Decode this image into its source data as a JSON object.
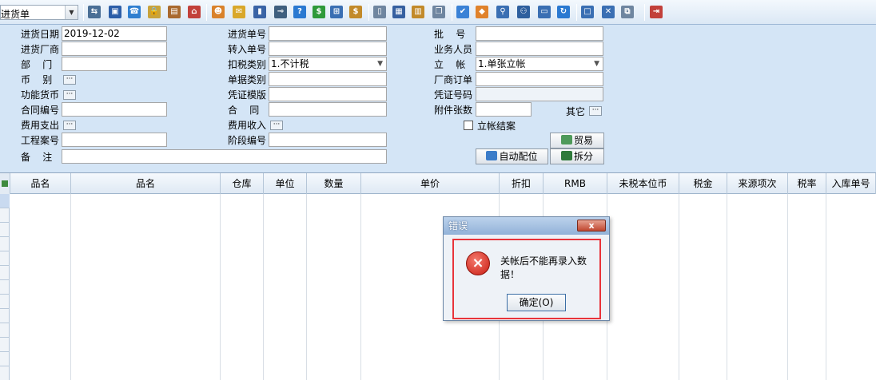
{
  "toolbar": {
    "doc_type_value": "进货单",
    "icons": [
      {
        "name": "split-icon",
        "glyph": "⇆",
        "color": "#4a6f96"
      },
      {
        "name": "monitor-icon",
        "glyph": "▣",
        "color": "#2c5ea8"
      },
      {
        "name": "phone-icon",
        "glyph": "☎",
        "color": "#2f7fd0"
      },
      {
        "name": "lock-icon",
        "glyph": "🔒",
        "color": "#c9a33a"
      },
      {
        "name": "briefcase-icon",
        "glyph": "▤",
        "color": "#a9692e"
      },
      {
        "name": "home-icon",
        "glyph": "⌂",
        "color": "#c2403a"
      },
      {
        "name": "users-icon",
        "glyph": "☻",
        "color": "#d9822b"
      },
      {
        "name": "mail-icon",
        "glyph": "✉",
        "color": "#d9a82b"
      },
      {
        "name": "book-icon",
        "glyph": "▮",
        "color": "#3a64a6"
      },
      {
        "name": "key-icon",
        "glyph": "⊸",
        "color": "#3f5f7f"
      },
      {
        "name": "help-icon",
        "glyph": "?",
        "color": "#2a79d1"
      },
      {
        "name": "dollar-icon",
        "glyph": "$",
        "color": "#2f9a3a"
      },
      {
        "name": "cart-icon",
        "glyph": "⊞",
        "color": "#3a6fb3"
      },
      {
        "name": "money-bag-icon",
        "glyph": "$",
        "color": "#c28a2a"
      },
      {
        "name": "document-icon",
        "glyph": "▯",
        "color": "#6f86a0"
      },
      {
        "name": "calculator-icon",
        "glyph": "▦",
        "color": "#3660a0"
      },
      {
        "name": "archive-icon",
        "glyph": "▥",
        "color": "#c28a2a"
      },
      {
        "name": "copy-icon",
        "glyph": "❐",
        "color": "#6f86a0"
      },
      {
        "name": "check-icon",
        "glyph": "✔",
        "color": "#3a82d6"
      },
      {
        "name": "bell-icon",
        "glyph": "◆",
        "color": "#e0822b"
      },
      {
        "name": "search-doc-icon",
        "glyph": "⚲",
        "color": "#3a6fb3"
      },
      {
        "name": "org-chart-icon",
        "glyph": "⚇",
        "color": "#2e5f9e"
      },
      {
        "name": "screen-icon",
        "glyph": "▭",
        "color": "#3a6fb3"
      },
      {
        "name": "refresh-icon",
        "glyph": "↻",
        "color": "#2a79d1"
      },
      {
        "name": "window-icon",
        "glyph": "□",
        "color": "#3a6fb3"
      },
      {
        "name": "close-window-icon",
        "glyph": "✕",
        "color": "#3a6fb3"
      },
      {
        "name": "tile-icon",
        "glyph": "⧉",
        "color": "#6f86a0"
      },
      {
        "name": "exit-icon",
        "glyph": "⇥",
        "color": "#c2403a"
      }
    ]
  },
  "form": {
    "purchase_date_label": "进货日期",
    "purchase_date_value": "2019-12-02",
    "supplier_label": "进货厂商",
    "dept_label": "部    门",
    "currency_label": "币    别",
    "func_currency_label": "功能货币",
    "contract_no_label": "合同编号",
    "expense_label": "费用支出",
    "project_no_label": "工程案号",
    "remark_label": "备    注",
    "purchase_no_label": "进货单号",
    "transfer_no_label": "转入单号",
    "tax_type_label": "扣税类别",
    "tax_type_value": "1.不计税",
    "doc_category_label": "单据类别",
    "voucher_template_label": "凭证模版",
    "contract_label": "合    同",
    "income_label": "费用收入",
    "stage_no_label": "阶段编号",
    "batch_label": "批    号",
    "salesperson_label": "业务人员",
    "account_label": "立    帐",
    "account_value": "1.单张立帐",
    "vendor_order_label": "厂商订单",
    "voucher_no_label": "凭证号码",
    "attachments_label": "附件张数",
    "other_label": "其它",
    "close_account_label": "立帐结案",
    "trade_button": "贸易",
    "auto_match_button": "自动配位",
    "split_button": "拆分"
  },
  "grid": {
    "columns": [
      "品名",
      "品名",
      "仓库",
      "单位",
      "数量",
      "单价",
      "折扣",
      "RMB",
      "未税本位币",
      "税金",
      "来源项次",
      "税率",
      "入库单号"
    ]
  },
  "dialog": {
    "title": "错误",
    "close_label": "x",
    "message": "关帐后不能再录入数据！",
    "ok_label": "确定(O)"
  }
}
